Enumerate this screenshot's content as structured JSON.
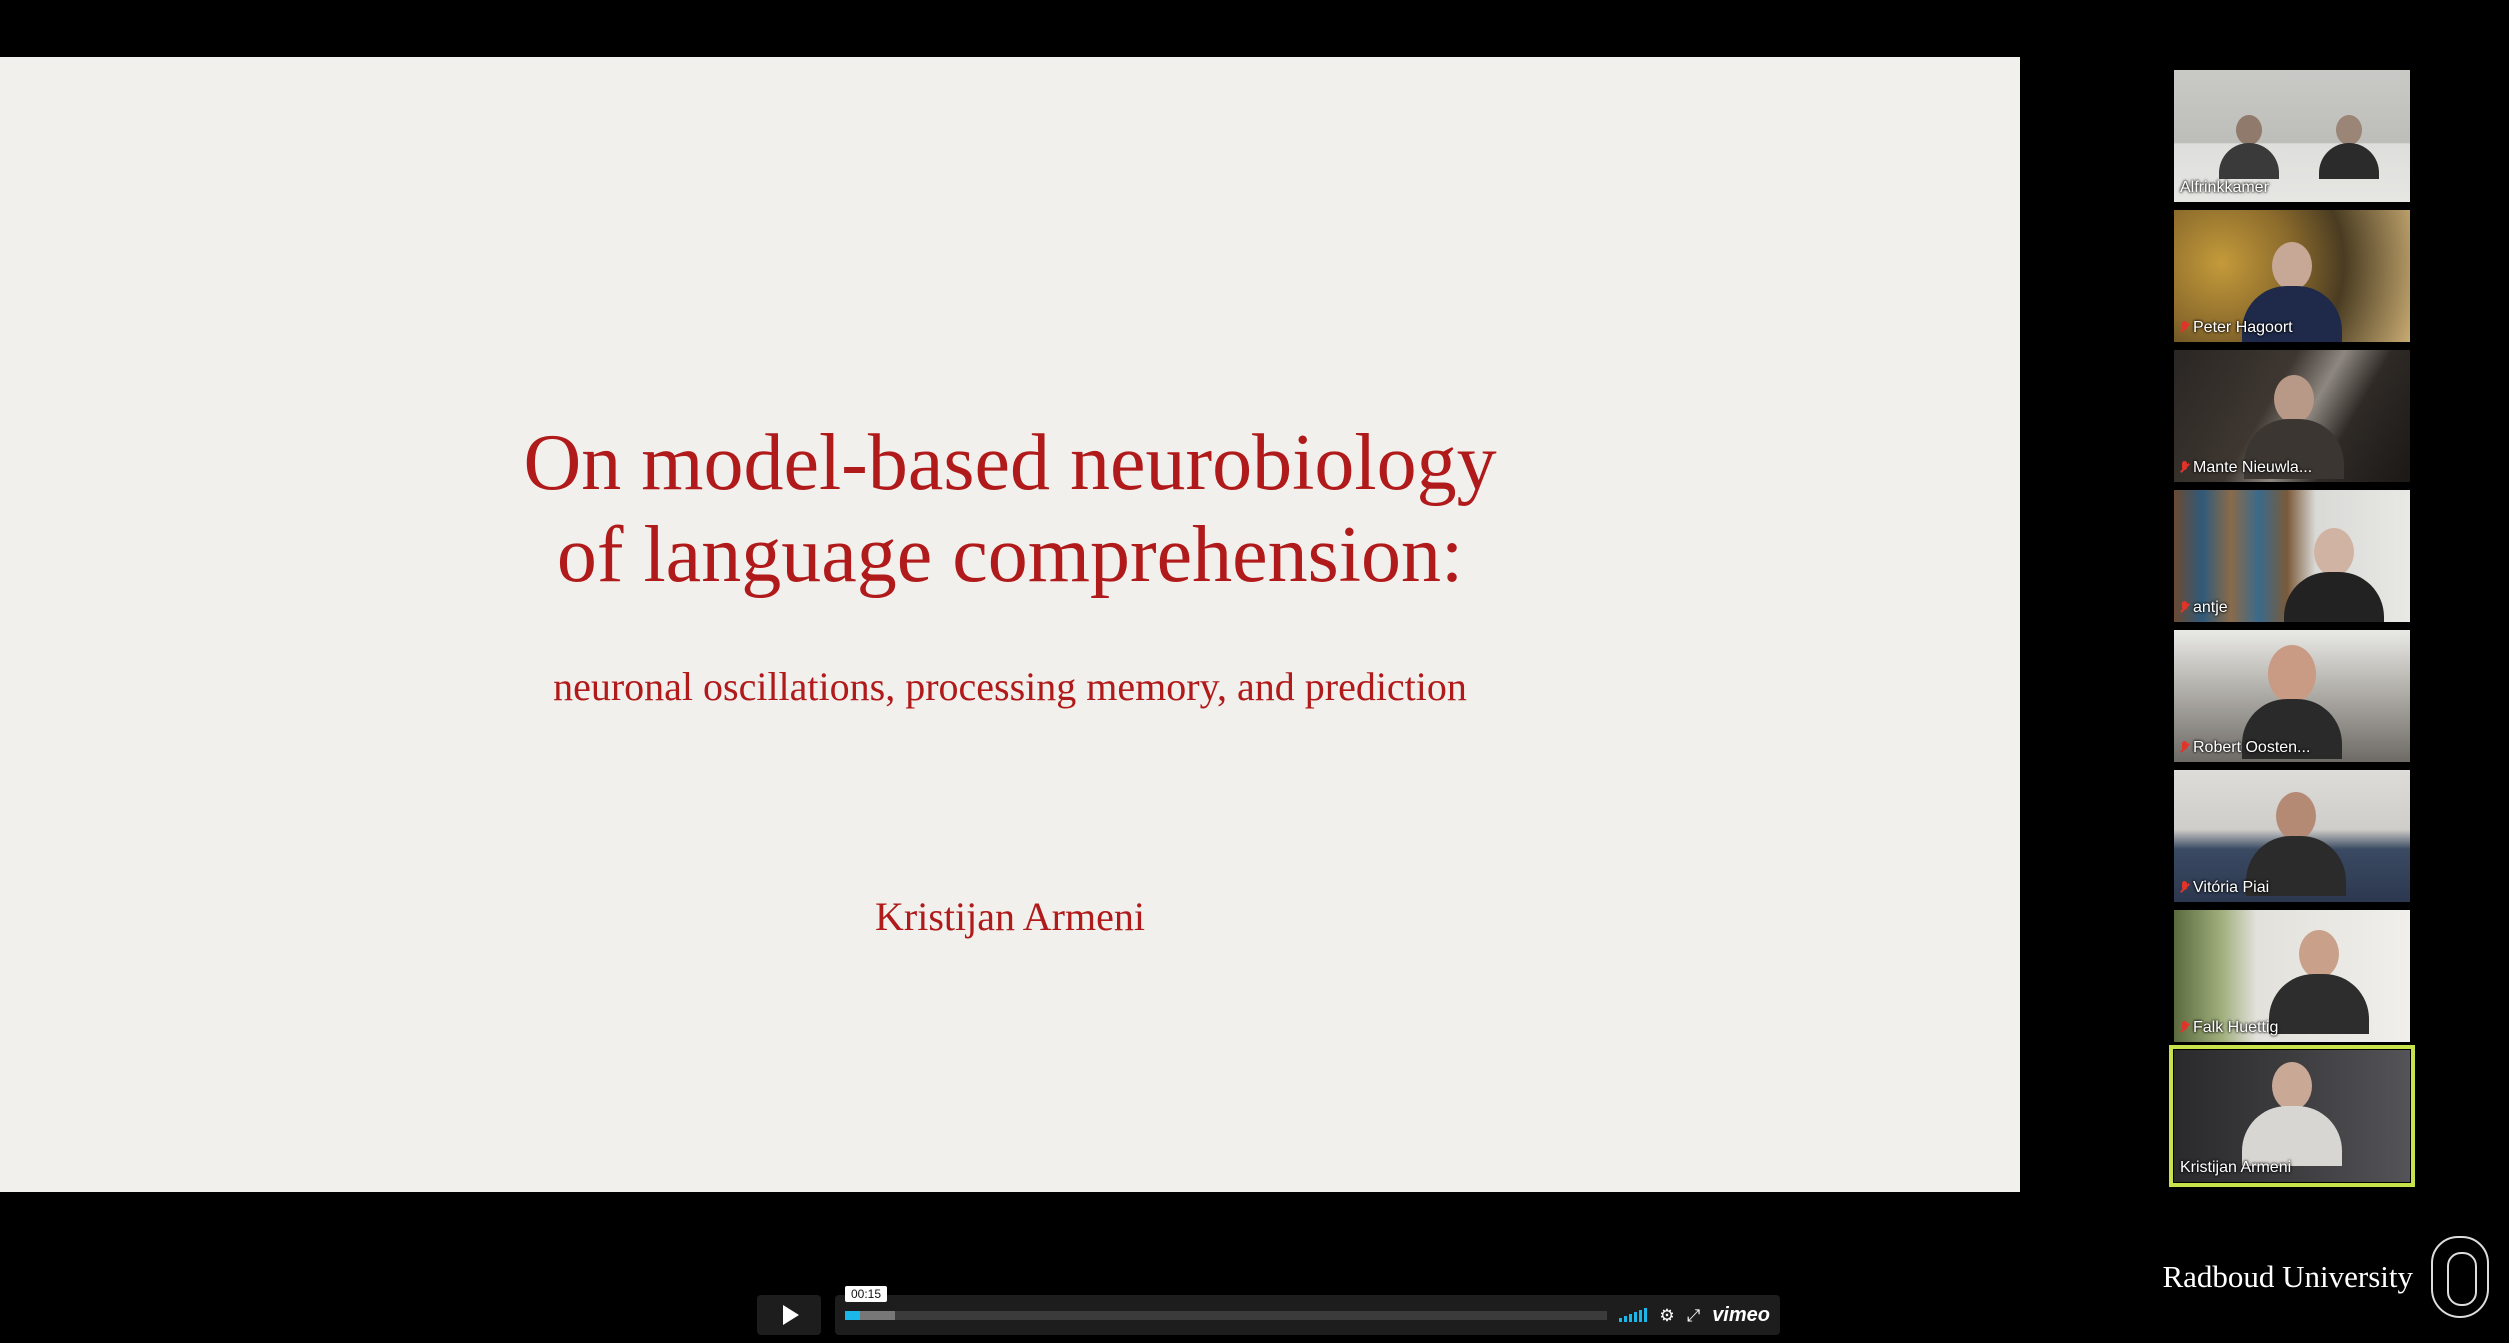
{
  "slide": {
    "title_line1": "On model-based neurobiology",
    "title_line2": "of language comprehension:",
    "subtitle": "neuronal oscillations, processing memory, and prediction",
    "author": "Kristijan Armeni"
  },
  "participants": [
    {
      "name": "Alfrinkkamer",
      "muted": false,
      "active": false
    },
    {
      "name": "Peter Hagoort",
      "muted": true,
      "active": false
    },
    {
      "name": "Mante Nieuwla...",
      "muted": true,
      "active": false
    },
    {
      "name": "antje",
      "muted": true,
      "active": false
    },
    {
      "name": "Robert Oosten...",
      "muted": true,
      "active": false
    },
    {
      "name": "Vitória Piai",
      "muted": true,
      "active": false
    },
    {
      "name": "Falk Huettig",
      "muted": true,
      "active": false
    },
    {
      "name": "Kristijan Armeni",
      "muted": false,
      "active": true
    }
  ],
  "branding": {
    "university": "Radboud University"
  },
  "player": {
    "current_time": "00:15",
    "played_fraction": 0.02,
    "loaded_fraction": 0.065,
    "brand": "vimeo",
    "accent_color": "#1ab7ea"
  }
}
